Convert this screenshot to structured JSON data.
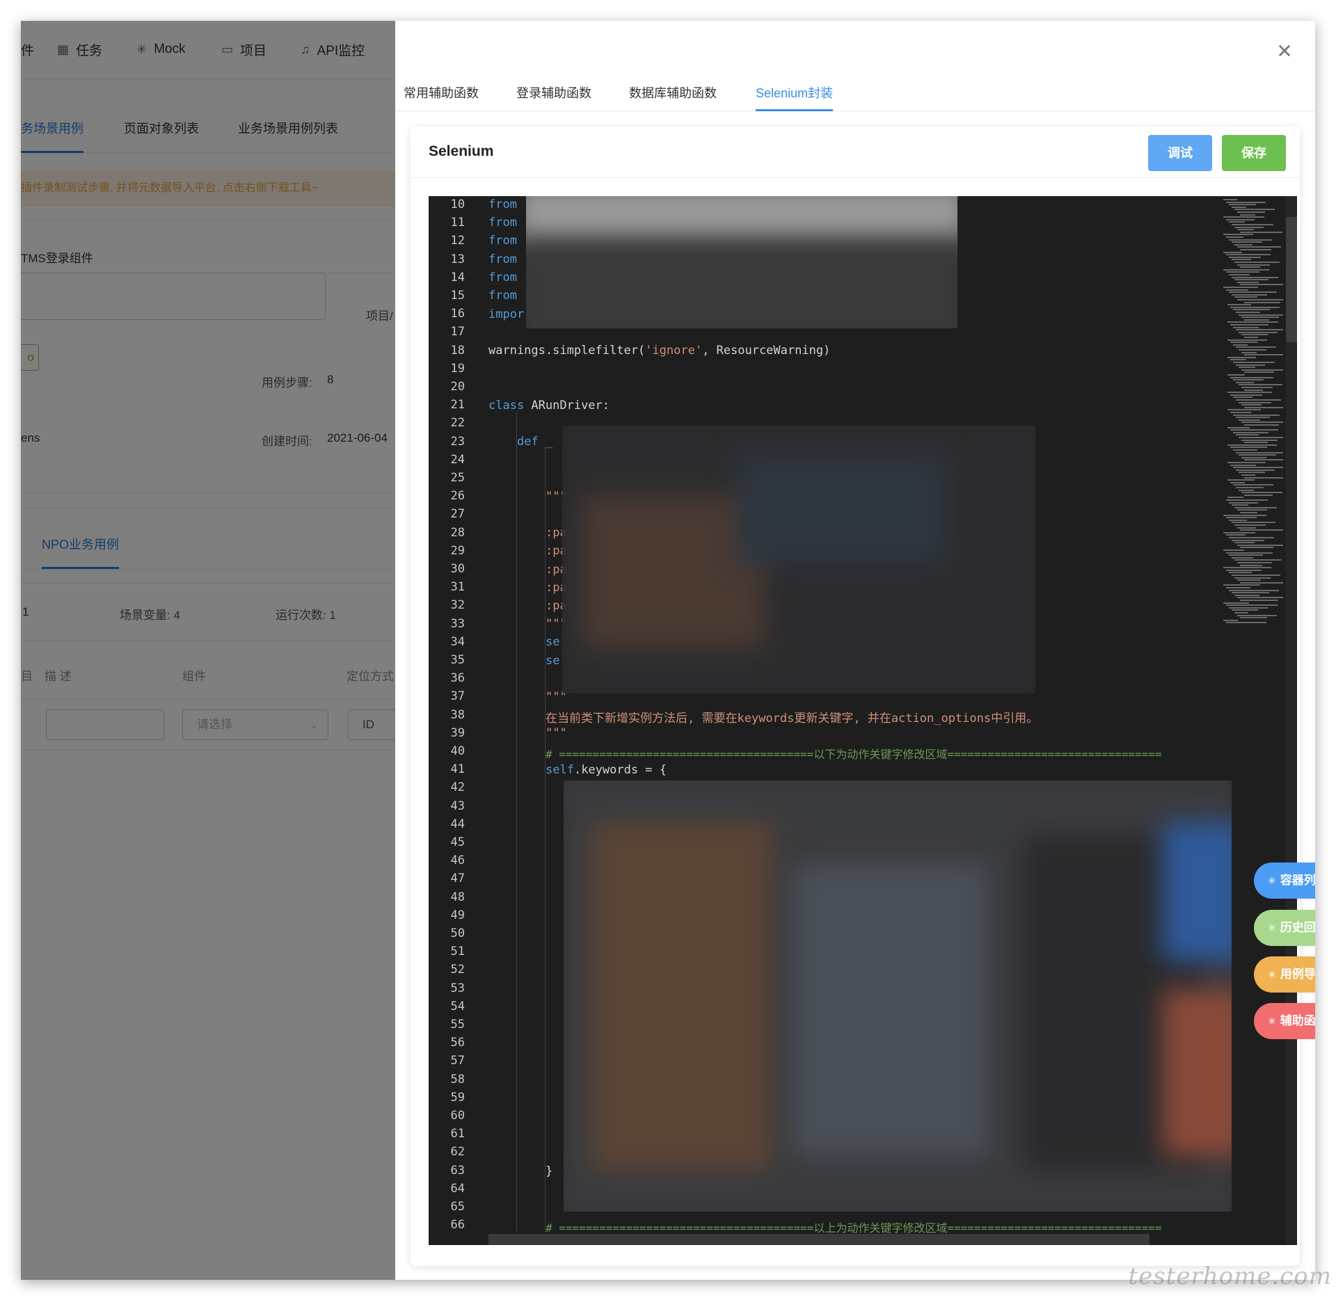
{
  "bg_app": {
    "nav": [
      {
        "icon": "plugin-icon",
        "label": "件"
      },
      {
        "icon": "calendar-icon",
        "label": "任务"
      },
      {
        "icon": "loading-icon",
        "label": "Mock"
      },
      {
        "icon": "folder-icon",
        "label": "项目"
      },
      {
        "icon": "bell-icon",
        "label": "API监控"
      }
    ],
    "tabs": [
      {
        "label": "务场景用例"
      },
      {
        "label": "页面对象列表"
      },
      {
        "label": "业务场景用例列表"
      }
    ],
    "notice": "插件录制测试步骤, 并将元数据导入平台, 点击右侧下载工具~",
    "component_name": "TMS登录组件",
    "project_label": "项目/",
    "tag_text": "o",
    "steps_label": "用例步骤:",
    "steps_value": "8",
    "owner_text": "ens",
    "created_label": "创建时间:",
    "created_value": "2021-06-04",
    "subtab": "NPO业务用例",
    "stat_first": "1",
    "scene_var": "场景变量: 4",
    "run_count": "运行次数: 1",
    "col_prefix": "目",
    "col_desc": "描 述",
    "col_component": "组件",
    "col_locator": "定位方式",
    "select_placeholder": "请选择",
    "locator_value": "ID"
  },
  "drawer": {
    "close_icon": "close-icon",
    "tabs": [
      {
        "label": "常用辅助函数"
      },
      {
        "label": "登录辅助函数"
      },
      {
        "label": "数据库辅助函数"
      },
      {
        "label": "Selenium封装"
      }
    ],
    "active_tab": "Selenium封装",
    "card_title": "Selenium",
    "debug_label": "调试",
    "save_label": "保存"
  },
  "editor": {
    "line_numbers": [
      "10",
      "11",
      "12",
      "13",
      "14",
      "15",
      "16",
      "17",
      "18",
      "19",
      "20",
      "21",
      "22",
      "23",
      "24",
      "25",
      "26",
      "27",
      "28",
      "29",
      "30",
      "31",
      "32",
      "33",
      "34",
      "35",
      "36",
      "37",
      "38",
      "39",
      "40",
      "41",
      "42",
      "43",
      "44",
      "45",
      "46",
      "47",
      "48",
      "49",
      "50",
      "51",
      "52",
      "53",
      "54",
      "55",
      "56",
      "57",
      "58",
      "59",
      "60",
      "61",
      "62",
      "63",
      "64",
      "65",
      "66"
    ],
    "l10": "from",
    "l11": "from",
    "l12": "from",
    "l13": "from",
    "l14": "from",
    "l15": "from",
    "l16": "impor",
    "l18_a": "warnings.simplefilter(",
    "l18_b": "'ignore'",
    "l18_c": ", ResourceWarning)",
    "l21_a": "class",
    "l21_b": " ARunDriver:",
    "l23_a": "def",
    "l23_b": " _",
    "l26": "\"\"\"",
    "l28": ":pa",
    "l29": ":pa",
    "l30": ":pa",
    "l31": ":pa",
    "l32": ":pa",
    "l33": "\"\"\"",
    "l34": "se",
    "l35": "se",
    "l37": "\"\"\"",
    "l38": "在当前类下新增实例方法后, 需要在keywords更新关键字, 并在action_options中引用。",
    "l39": "\"\"\"",
    "l40": "# ======================================以下为动作关键字修改区域================================",
    "l41_a": "self",
    "l41_b": ".keywords = {",
    "l65": "}",
    "l66": "# ======================================以上为动作关键字修改区域================================"
  },
  "float_buttons": [
    {
      "icon": "spinner-icon",
      "label": "容器列表",
      "color": "#4b9cf5"
    },
    {
      "icon": "spinner-icon",
      "label": "历史回放",
      "color": "#a8d88e"
    },
    {
      "icon": "spinner-icon",
      "label": "用例导入",
      "color": "#f0b252"
    },
    {
      "icon": "spinner-icon",
      "label": "辅助函数",
      "color": "#f26d6d"
    }
  ],
  "watermark": "testerhome.com"
}
